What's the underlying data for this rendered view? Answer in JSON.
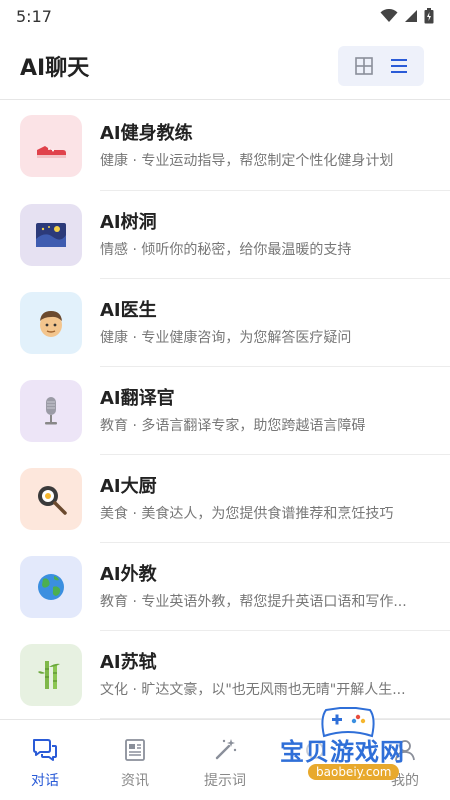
{
  "status_bar": {
    "time": "5:17"
  },
  "header": {
    "title": "AI聊天"
  },
  "chats": [
    {
      "name": "AI健身教练",
      "desc": "健康 · 专业运动指导，帮您制定个性化健身计划",
      "icon": "sneaker-icon",
      "bg": "#fbe3e6"
    },
    {
      "name": "AI树洞",
      "desc": "情感 · 倾听你的秘密，给你最温暖的支持",
      "icon": "starry-night-icon",
      "bg": "#e6e1f2"
    },
    {
      "name": "AI医生",
      "desc": "健康 · 专业健康咨询，为您解答医疗疑问",
      "icon": "doctor-face-icon",
      "bg": "#e2f1fb"
    },
    {
      "name": "AI翻译官",
      "desc": "教育 · 多语言翻译专家，助您跨越语言障碍",
      "icon": "microphone-icon",
      "bg": "#ede5f7"
    },
    {
      "name": "AI大厨",
      "desc": "美食 · 美食达人，为您提供食谱推荐和烹饪技巧",
      "icon": "frying-pan-icon",
      "bg": "#fde7dc"
    },
    {
      "name": "AI外教",
      "desc": "教育 · 专业英语外教，帮您提升英语口语和写作...",
      "icon": "globe-icon",
      "bg": "#e3e9fb"
    },
    {
      "name": "AI苏轼",
      "desc": "文化 · 旷达文豪，以\"也无风雨也无晴\"开解人生...",
      "icon": "bamboo-icon",
      "bg": "#e7f1e1"
    }
  ],
  "tabs": [
    {
      "label": "对话",
      "icon": "chat-bubbles-icon",
      "active": true
    },
    {
      "label": "资讯",
      "icon": "news-icon",
      "active": false
    },
    {
      "label": "提示词",
      "icon": "magic-wand-icon",
      "active": false
    },
    {
      "label": "",
      "icon": "unknown-icon",
      "active": false
    },
    {
      "label": "我的",
      "icon": "profile-icon",
      "active": false
    }
  ],
  "watermark": {
    "text": "宝贝游戏网",
    "url": "baobeiy.com"
  },
  "colors": {
    "accent": "#2a5bd7",
    "toggle_bg": "#eef1fa"
  }
}
